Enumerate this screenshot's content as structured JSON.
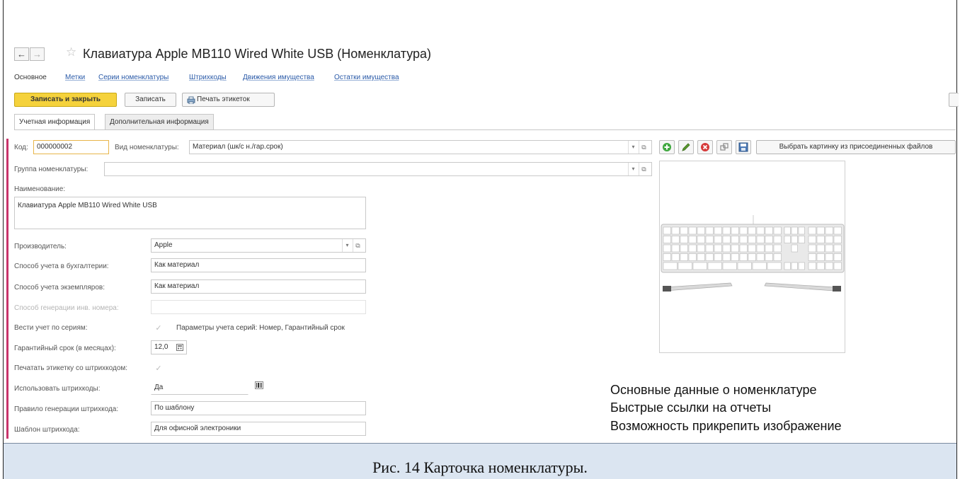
{
  "window": {
    "title": "Клавиатура Apple MB110 Wired White USB (Номенклатура)",
    "back_icon": "←",
    "forward_icon": "→",
    "favorite_icon": "☆"
  },
  "nav_links": [
    "Основное",
    "Метки",
    "Серии номенклатуры",
    "Штрихкоды",
    "Движения имущества",
    "Остатки имущества"
  ],
  "toolbar": {
    "save_close": "Записать и закрыть",
    "save": "Записать",
    "print_labels": "Печать этикеток"
  },
  "tabs": [
    "Учетная информация",
    "Дополнительная информация"
  ],
  "form": {
    "code_label": "Код:",
    "code_value": "000000002",
    "kind_label": "Вид номенклатуры:",
    "kind_value": "Материал (шк/с н./гар.срок)",
    "pick_picture": "Выбрать картинку из присоединенных файлов",
    "group_label": "Группа номенклатуры:",
    "group_value": "",
    "name_label": "Наименование:",
    "name_value": "Клавиатура Apple MB110 Wired White USB",
    "manufacturer_label": "Производитель:",
    "manufacturer_value": "Apple",
    "accounting_label": "Способ учета в бухгалтерии:",
    "accounting_value": "Как материал",
    "instances_label": "Способ учета экземпляров:",
    "instances_value": "Как материал",
    "inv_gen_label": "Способ генерации инв. номера:",
    "inv_gen_value": "",
    "series_label": "Вести учет по сериям:",
    "series_params": "Параметры учета серий: Номер, Гарантийный срок",
    "warranty_label": "Гарантийный срок (в месяцах):",
    "warranty_value": "12,0",
    "print_barcode_label": "Печатать этикетку со штрихкодом:",
    "use_barcodes_label": "Использовать штрихкоды:",
    "use_barcodes_value": "Да",
    "barcode_rule_label": "Правило генерации штрихкода:",
    "barcode_rule_value": "По шаблону",
    "barcode_template_label": "Шаблон штрихкода:",
    "barcode_template_value": "Для офисной электроники"
  },
  "notes": [
    "Основные данные о номенклатуре",
    "Быстрые ссылки на отчеты",
    "Возможность прикрепить изображение"
  ],
  "caption": "Рис. 14 Карточка номенклатуры."
}
